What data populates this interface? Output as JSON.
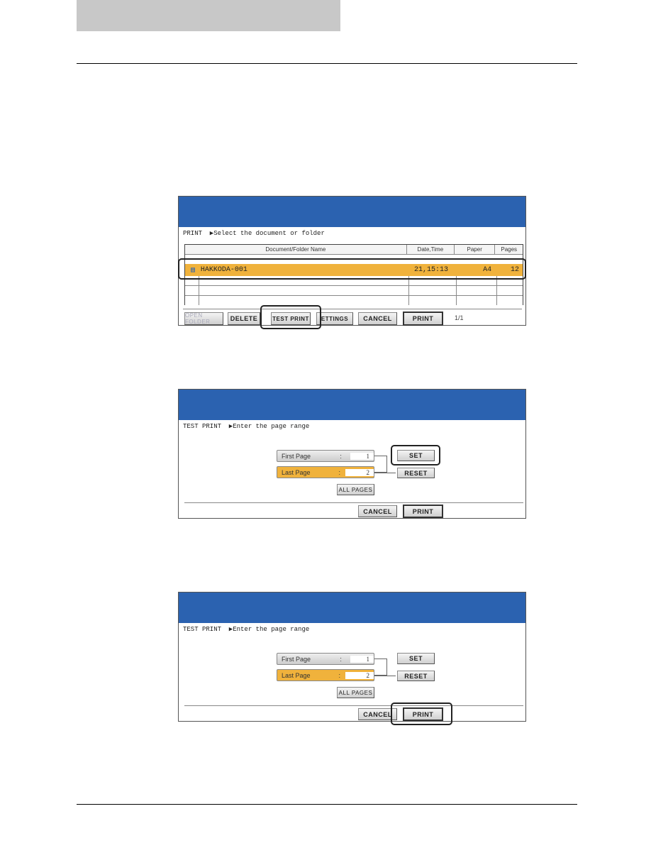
{
  "colors": {
    "header": "#2b62b0",
    "highlight": "#f0b23c",
    "bar": "#c8c8c8"
  },
  "screen1": {
    "prompt": "PRINT  ▶Select the document or folder",
    "columns": [
      "Document/Folder Name",
      "Date,Time",
      "Paper",
      "Pages"
    ],
    "row": {
      "icon": "document-icon",
      "name": "HAKKODA-001",
      "date": "21,15:13",
      "paper": "A4",
      "pages": "12"
    },
    "buttons": {
      "open_folder": "OPEN FOLDER",
      "delete": "DELETE",
      "test_print": "TEST PRINT",
      "settings": "ETTINGS",
      "cancel": "CANCEL",
      "print": "PRINT"
    },
    "page_count": "1/1"
  },
  "screen2": {
    "prompt": "TEST PRINT  ▶Enter the page range",
    "first_page": {
      "label": "First Page",
      "sep": ":",
      "value": "1"
    },
    "last_page": {
      "label": "Last Page",
      "sep": ":",
      "value": "2"
    },
    "buttons": {
      "set": "SET",
      "reset": "RESET",
      "all_pages": "ALL PAGES",
      "cancel": "CANCEL",
      "print": "PRINT"
    }
  },
  "screen3": {
    "prompt": "TEST PRINT  ▶Enter the page range",
    "first_page": {
      "label": "First Page",
      "sep": ":",
      "value": "1"
    },
    "last_page": {
      "label": "Last Page",
      "sep": ":",
      "value": "2"
    },
    "buttons": {
      "set": "SET",
      "reset": "RESET",
      "all_pages": "ALL PAGES",
      "cancel": "CANCEL",
      "print": "PRINT"
    }
  }
}
